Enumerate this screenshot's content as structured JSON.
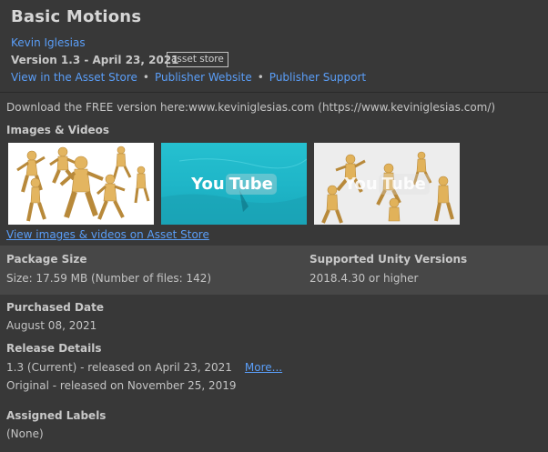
{
  "header": {
    "title": "Basic Motions",
    "author": "Kevin Iglesias",
    "version": "Version 1.3 - April 23, 2021",
    "tag": "asset store",
    "links": [
      "View in the Asset Store",
      "Publisher Website",
      "Publisher Support"
    ]
  },
  "description": "Download the FREE version here:www.keviniglesias.com (https://www.keviniglesias.com/)",
  "media": {
    "heading": "Images & Videos",
    "youtube_text_1": "You",
    "youtube_text_2": "Tube",
    "view_link": "View images & videos on Asset Store"
  },
  "package": {
    "size_heading": "Package Size",
    "size_value": "Size: 17.59 MB (Number of files: 142)",
    "unity_heading": "Supported Unity Versions",
    "unity_value": "2018.4.30 or higher"
  },
  "purchased": {
    "heading": "Purchased Date",
    "value": "August 08, 2021"
  },
  "release": {
    "heading": "Release Details",
    "current": "1.3 (Current) - released on April 23, 2021",
    "more": "More...",
    "original": "Original - released on November 25, 2019"
  },
  "labels": {
    "heading": "Assigned Labels",
    "value": "(None)"
  },
  "colors": {
    "background": "#383838",
    "band": "#474747",
    "link": "#5a9ef8"
  }
}
